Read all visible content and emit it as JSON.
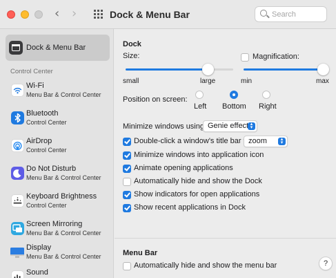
{
  "window": {
    "title": "Dock & Menu Bar"
  },
  "search": {
    "placeholder": "Search"
  },
  "sidebar": {
    "selected": {
      "title": "Dock & Menu Bar",
      "icon": "dock-menubar-icon"
    },
    "section_label": "Control Center",
    "items": [
      {
        "title": "Wi-Fi",
        "subtitle": "Menu Bar & Control Center",
        "icon": "wifi-icon",
        "color": "#ffffff"
      },
      {
        "title": "Bluetooth",
        "subtitle": "Control Center",
        "icon": "bluetooth-icon",
        "color": "#1f7ae0"
      },
      {
        "title": "AirDrop",
        "subtitle": "Control Center",
        "icon": "airdrop-icon",
        "color": "#1f7ae0"
      },
      {
        "title": "Do Not Disturb",
        "subtitle": "Menu Bar & Control Center",
        "icon": "moon-icon",
        "color": "#5e5ce6"
      },
      {
        "title": "Keyboard Brightness",
        "subtitle": "Control Center",
        "icon": "keyboard-brightness-icon",
        "color": "#ffffff"
      },
      {
        "title": "Screen Mirroring",
        "subtitle": "Menu Bar & Control Center",
        "icon": "screen-mirroring-icon",
        "color": "#2fa8e0"
      },
      {
        "title": "Display",
        "subtitle": "Menu Bar & Control Center",
        "icon": "display-icon",
        "color": "#2a7de1"
      },
      {
        "title": "Sound",
        "subtitle": "",
        "icon": "sound-icon",
        "color": "#ffffff"
      }
    ]
  },
  "dock": {
    "header": "Dock",
    "size_label": "Size:",
    "size_min": "small",
    "size_max": "large",
    "size_value": 0.76,
    "magnification_label": "Magnification:",
    "magnification_checked": false,
    "mag_min": "min",
    "mag_max": "max",
    "mag_value": 1.0,
    "position_label": "Position on screen:",
    "positions": [
      {
        "label": "Left",
        "selected": false
      },
      {
        "label": "Bottom",
        "selected": true
      },
      {
        "label": "Right",
        "selected": false
      }
    ],
    "minimize_label": "Minimize windows using:",
    "minimize_value": "Genie effect",
    "doubleclick_label": "Double-click a window's title bar to",
    "doubleclick_value": "zoom",
    "options": [
      {
        "label": "Minimize windows into application icon",
        "checked": true
      },
      {
        "label": "Animate opening applications",
        "checked": true
      },
      {
        "label": "Automatically hide and show the Dock",
        "checked": false
      },
      {
        "label": "Show indicators for open applications",
        "checked": true
      },
      {
        "label": "Show recent applications in Dock",
        "checked": true
      }
    ]
  },
  "menubar": {
    "header": "Menu Bar",
    "autohide_label": "Automatically hide and show the menu bar",
    "autohide_checked": false
  },
  "help": {
    "label": "?"
  },
  "colors": {
    "accent": "#1f7ae0",
    "close": "#ff5f57",
    "minimize": "#febc2e"
  }
}
